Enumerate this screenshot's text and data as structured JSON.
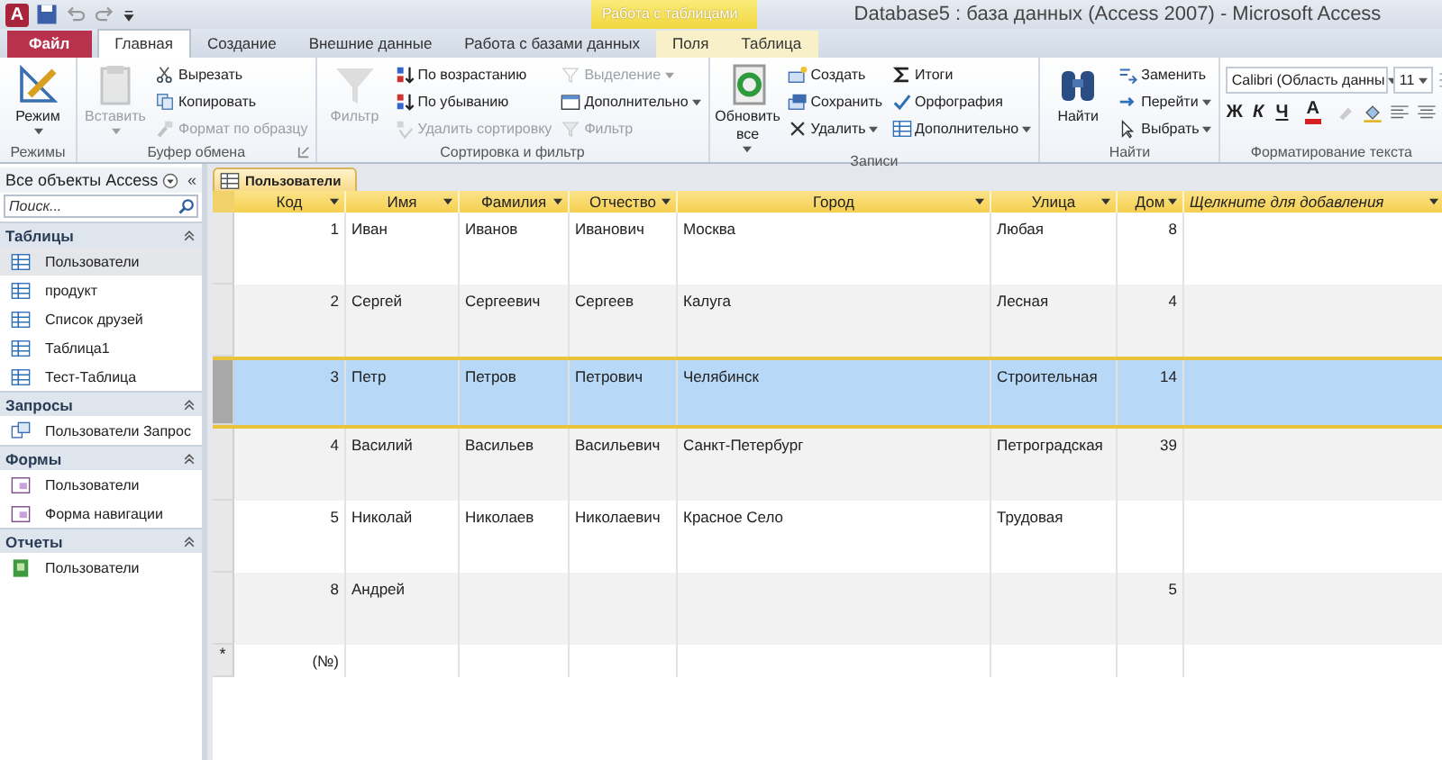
{
  "window": {
    "title": "Database5 : база данных (Access 2007)  -  Microsoft Access"
  },
  "app_logo": "A",
  "context_tab_group": "Работа с таблицами",
  "ribbon_tabs": [
    {
      "label": "Файл",
      "kind": "file",
      "selected": false
    },
    {
      "label": "Главная",
      "kind": "normal",
      "selected": true
    },
    {
      "label": "Создание",
      "kind": "normal",
      "selected": false
    },
    {
      "label": "Внешние данные",
      "kind": "normal",
      "selected": false
    },
    {
      "label": "Работа с базами данных",
      "kind": "normal",
      "selected": false
    },
    {
      "label": "Поля",
      "kind": "context",
      "selected": false
    },
    {
      "label": "Таблица",
      "kind": "context",
      "selected": false
    }
  ],
  "ribbon_groups": [
    {
      "title": "Режимы",
      "kind": "buttons",
      "columns": [
        [
          {
            "label": "Режим",
            "kind": "large",
            "disabled": false,
            "dropdown": true
          }
        ]
      ]
    },
    {
      "title": "Буфер обмена",
      "kind": "buttons",
      "launcher": true,
      "columns": [
        [
          {
            "label": "Вставить",
            "kind": "large",
            "disabled": true,
            "dropdown": true
          }
        ],
        [
          {
            "label": "Вырезать",
            "kind": "small",
            "disabled": false,
            "dropdown": false
          },
          {
            "label": "Копировать",
            "kind": "small",
            "disabled": false,
            "dropdown": false
          },
          {
            "label": "Формат по образцу",
            "kind": "small",
            "disabled": true,
            "dropdown": false
          }
        ]
      ]
    },
    {
      "title": "Сортировка и фильтр",
      "kind": "buttons",
      "columns": [
        [
          {
            "label": "Фильтр",
            "kind": "large",
            "disabled": true,
            "dropdown": false
          }
        ],
        [
          {
            "label": "По возрастанию",
            "kind": "small",
            "disabled": false,
            "dropdown": false
          },
          {
            "label": "По убыванию",
            "kind": "small",
            "disabled": false,
            "dropdown": false
          },
          {
            "label": "Удалить сортировку",
            "kind": "small",
            "disabled": true,
            "dropdown": false
          }
        ],
        [
          {
            "label": "Выделение",
            "kind": "small",
            "disabled": true,
            "dropdown": true
          },
          {
            "label": "Дополнительно",
            "kind": "small",
            "disabled": false,
            "dropdown": true
          },
          {
            "label": "Фильтр",
            "kind": "small",
            "disabled": true,
            "dropdown": false
          }
        ]
      ]
    },
    {
      "title": "Записи",
      "kind": "buttons",
      "columns": [
        [
          {
            "label": "Обновить все",
            "kind": "large",
            "disabled": false,
            "dropdown": true
          }
        ],
        [
          {
            "label": "Создать",
            "kind": "small",
            "disabled": false,
            "dropdown": false
          },
          {
            "label": "Сохранить",
            "kind": "small",
            "disabled": false,
            "dropdown": false
          },
          {
            "label": "Удалить",
            "kind": "small",
            "disabled": false,
            "dropdown": true
          }
        ],
        [
          {
            "label": "Итоги",
            "kind": "small",
            "disabled": false,
            "dropdown": false
          },
          {
            "label": "Орфография",
            "kind": "small",
            "disabled": false,
            "dropdown": false
          },
          {
            "label": "Дополнительно",
            "kind": "small",
            "disabled": false,
            "dropdown": true
          }
        ]
      ]
    },
    {
      "title": "Найти",
      "kind": "buttons",
      "columns": [
        [
          {
            "label": "Найти",
            "kind": "large",
            "disabled": false,
            "dropdown": false
          }
        ],
        [
          {
            "label": "Заменить",
            "kind": "small",
            "disabled": false,
            "dropdown": false
          },
          {
            "label": "Перейти",
            "kind": "small",
            "disabled": false,
            "dropdown": true
          },
          {
            "label": "Выбрать",
            "kind": "small",
            "disabled": false,
            "dropdown": true
          }
        ]
      ]
    },
    {
      "title": "Форматирование текста",
      "kind": "font",
      "font": {
        "value": "Calibri (Область данны"
      },
      "size": {
        "value": "11"
      },
      "styles": [
        "Ж",
        "К",
        "Ч"
      ],
      "color_letter": "A"
    }
  ],
  "navigation": {
    "title": "Все объекты Access",
    "collapse": "«",
    "search": {
      "placeholder": "Поиск..."
    },
    "groups": [
      {
        "title": "Таблицы",
        "kind": "table",
        "expanded": true,
        "items": [
          {
            "label": "Пользователи",
            "selected": true
          },
          {
            "label": "продукт",
            "selected": false
          },
          {
            "label": "Список друзей",
            "selected": false
          },
          {
            "label": "Таблица1",
            "selected": false
          },
          {
            "label": "Тест-Таблица",
            "selected": false
          }
        ]
      },
      {
        "title": "Запросы",
        "kind": "query",
        "expanded": true,
        "items": [
          {
            "label": "Пользователи Запрос",
            "selected": false
          }
        ]
      },
      {
        "title": "Формы",
        "kind": "form",
        "expanded": true,
        "items": [
          {
            "label": "Пользователи",
            "selected": false
          },
          {
            "label": "Форма навигации",
            "selected": false
          }
        ]
      },
      {
        "title": "Отчеты",
        "kind": "report",
        "expanded": true,
        "items": [
          {
            "label": "Пользователи",
            "selected": false
          }
        ]
      }
    ]
  },
  "document_tab": {
    "label": "Пользователи"
  },
  "table": {
    "columns": [
      {
        "label": "Код",
        "kind": "number"
      },
      {
        "label": "Имя",
        "kind": "text"
      },
      {
        "label": "Фамилия",
        "kind": "text"
      },
      {
        "label": "Отчество",
        "kind": "text"
      },
      {
        "label": "Город",
        "kind": "text"
      },
      {
        "label": "Улица",
        "kind": "text"
      },
      {
        "label": "Дом",
        "kind": "number"
      },
      {
        "label": "Щелкните для добавления",
        "kind": "add"
      }
    ],
    "rows": [
      {
        "selected": false,
        "cells": [
          "1",
          "Иван",
          "Иванов",
          "Иванович",
          "Москва",
          "Любая",
          "8",
          null
        ]
      },
      {
        "selected": false,
        "cells": [
          "2",
          "Сергей",
          "Сергеевич",
          "Сергеев",
          "Калуга",
          "Лесная",
          "4",
          null
        ]
      },
      {
        "selected": true,
        "cells": [
          "3",
          "Петр",
          "Петров",
          "Петрович",
          "Челябинск",
          "Строительная",
          "14",
          null
        ]
      },
      {
        "selected": false,
        "cells": [
          "4",
          "Василий",
          "Васильев",
          "Васильевич",
          "Санкт-Петербург",
          "Петроградская",
          "39",
          null
        ]
      },
      {
        "selected": false,
        "cells": [
          "5",
          "Николай",
          "Николаев",
          "Николаевич",
          "Красное Село",
          "Трудовая",
          null,
          null
        ]
      },
      {
        "selected": false,
        "cells": [
          "8",
          "Андрей",
          null,
          null,
          null,
          null,
          "5",
          null
        ]
      }
    ],
    "new_row": {
      "marker": "*",
      "cells": [
        "(№)"
      ]
    }
  }
}
